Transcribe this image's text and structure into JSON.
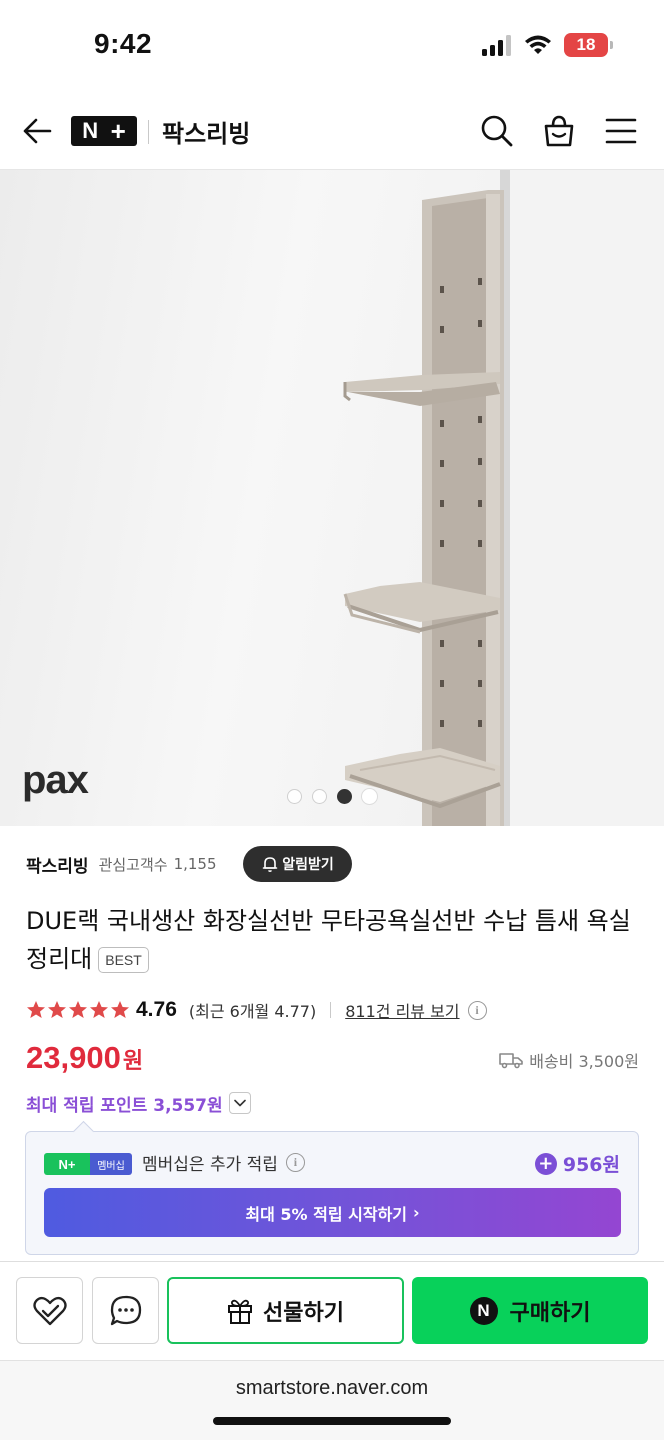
{
  "status": {
    "time": "9:42",
    "battery": "18"
  },
  "header": {
    "logo_n": "N",
    "logo_plus": "+",
    "store_name": "팍스리빙"
  },
  "hero": {
    "brand_logo": "pax",
    "slide_total": 4,
    "slide_active": 3
  },
  "store": {
    "name": "팍스리빙",
    "fav_label": "관심고객수",
    "fav_count": "1,155",
    "alarm_label": "알림받기"
  },
  "product": {
    "title": "DUE랙 국내생산 화장실선반 무타공욕실선반 수납 틈새 욕실정리대",
    "badge": "BEST",
    "rating": "4.76",
    "stars": 5,
    "rating_recent": "(최근 6개월 4.77)",
    "reviews_link": "811건 리뷰 보기",
    "price": "23,900",
    "currency": "원",
    "shipping": "배송비 3,500원",
    "points_label": "최대 적립 포인트 3,557원"
  },
  "membership": {
    "badge_left": "N+",
    "badge_right": "멤버십",
    "text": "멤버십은 추가 적립",
    "points": "956원",
    "cta": "최대 5% 적립 시작하기",
    "cta_chevron": "›"
  },
  "actions": {
    "gift_label": "선물하기",
    "buy_label": "구매하기",
    "buy_icon_letter": "N"
  },
  "browser": {
    "url": "smartstore.naver.com"
  },
  "colors": {
    "accent_green": "#08d15a",
    "price_red": "#e02a3c",
    "point_purple": "#8a4fd6"
  }
}
